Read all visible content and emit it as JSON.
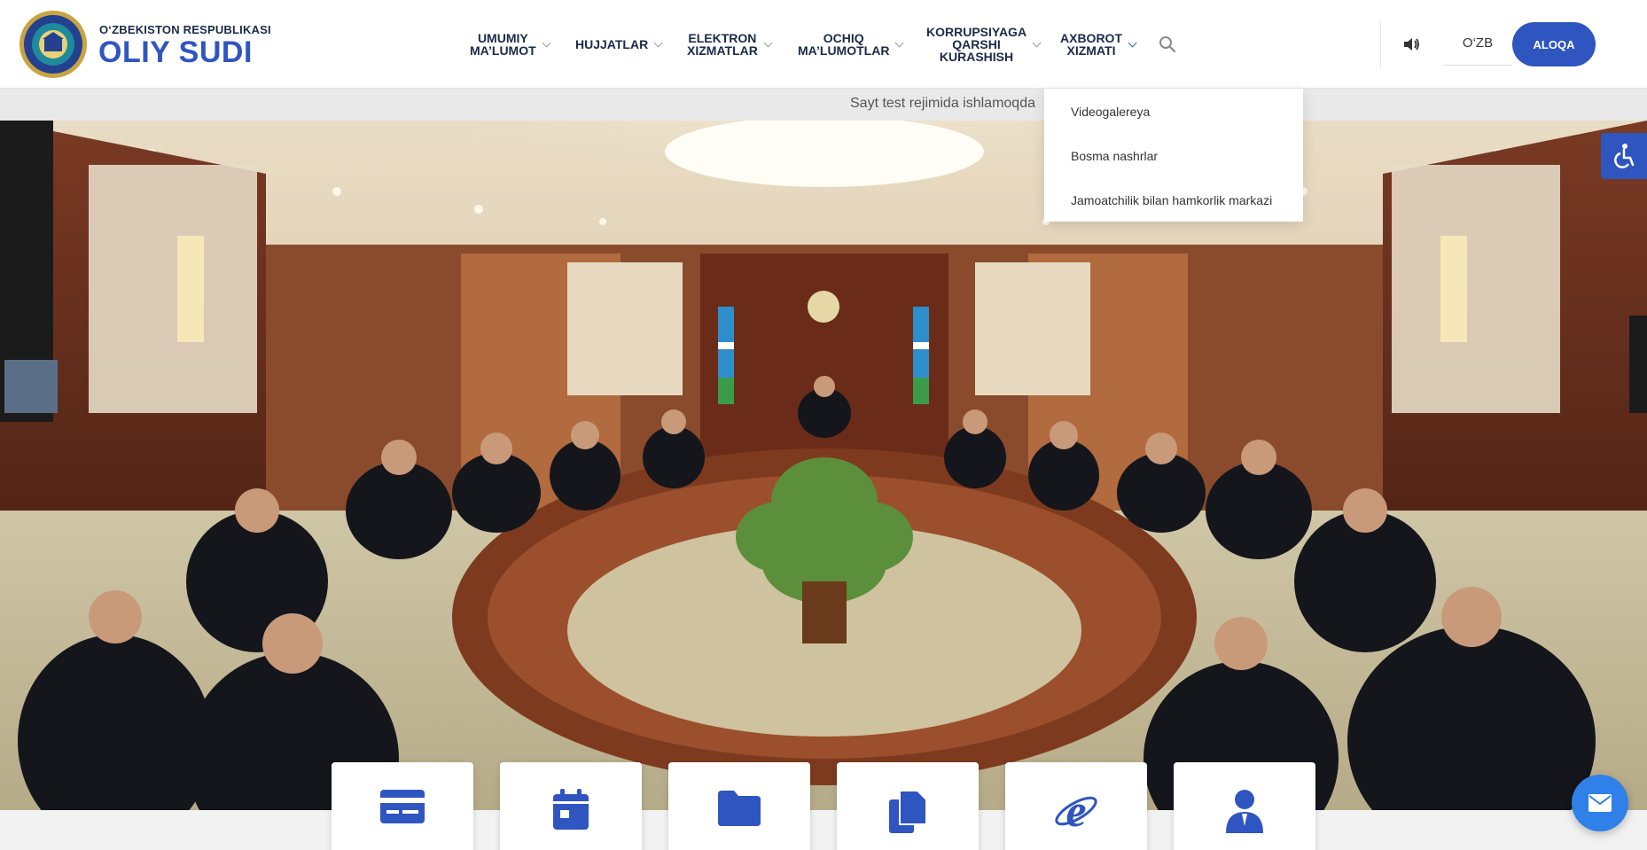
{
  "brand": {
    "top_line": "O‘ZBEKISTON RESPUBLIKASI",
    "name": "OLIY SUDI"
  },
  "nav": [
    {
      "label": "UMUMIY\nMA’LUMOT"
    },
    {
      "label": "HUJJATLAR"
    },
    {
      "label": "ELEKTRON\nXIZMATLAR"
    },
    {
      "label": "OCHIQ\nMA’LUMOTLAR"
    },
    {
      "label": "KORRUPSIYAGA\nQARSHI\nKURASHISH"
    },
    {
      "label": "AXBOROT\nXIZMATI"
    }
  ],
  "language": "O‘ZB",
  "contact_label": "ALOQA",
  "notice": "Sayt test rejimida ishlamoqda",
  "dropdown": {
    "parent": "AXBOROT XIZMATI",
    "items": [
      "Videogalereya",
      "Bosma nashrlar",
      "Jamoatchilik bilan hamkorlik markazi"
    ]
  },
  "service_cards": [
    {
      "icon": "card-icon"
    },
    {
      "icon": "calendar-icon"
    },
    {
      "icon": "folder-icon"
    },
    {
      "icon": "documents-icon"
    },
    {
      "icon": "internet-explorer-icon"
    },
    {
      "icon": "user-icon"
    }
  ],
  "colors": {
    "brand_blue": "#2f55c0",
    "nav_text": "#1b2a4a",
    "chat_blue": "#2f80e8"
  }
}
